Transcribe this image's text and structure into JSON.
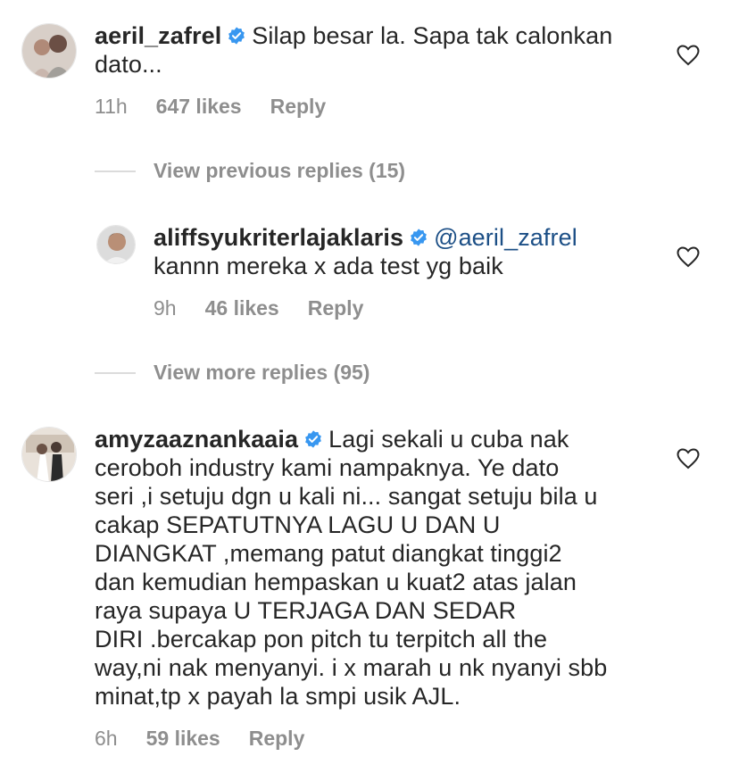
{
  "comments": [
    {
      "username": "aeril_zafrel",
      "line1": "Silap besar la. Sapa tak calonkan",
      "line2": "dato...",
      "time": "11h",
      "likes": "647 likes",
      "reply": "Reply"
    }
  ],
  "view_previous": "View previous replies (15)",
  "reply_comment": {
    "username": "aliffsyukriterlajaklaris",
    "mention": "@aeril_zafrel",
    "text": "kannn mereka x ada test yg baik",
    "time": "9h",
    "likes": "46 likes",
    "reply": "Reply"
  },
  "view_more": "View more replies (95)",
  "third_comment": {
    "username": "amyzaaznankaaia",
    "lines": [
      "Lagi sekali u cuba nak",
      "ceroboh industry kami  nampaknya. Ye dato",
      "seri ,i setuju dgn u kali ni... sangat setuju bila u",
      "cakap SEPATUTNYA LAGU U DAN U",
      "DIANGKAT ,memang patut diangkat tinggi2",
      "dan kemudian hempaskan u kuat2 atas jalan",
      "raya supaya U TERJAGA DAN SEDAR",
      "DIRI .bercakap pon pitch tu terpitch all the",
      "way,ni nak menyanyi. i x marah u nk nyanyi sbb",
      "minat,tp x payah la smpi usik AJL."
    ],
    "time": "6h",
    "likes": "59 likes",
    "reply": "Reply"
  },
  "colors": {
    "verified": "#3897f0",
    "meta": "#8e8e8e",
    "mention": "#1c4f86"
  }
}
